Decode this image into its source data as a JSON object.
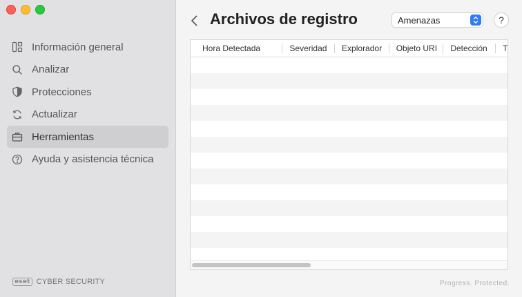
{
  "sidebar": {
    "items": [
      {
        "label": "Información general",
        "icon": "dashboard-icon"
      },
      {
        "label": "Analizar",
        "icon": "search-icon"
      },
      {
        "label": "Protecciones",
        "icon": "shield-icon"
      },
      {
        "label": "Actualizar",
        "icon": "refresh-icon"
      },
      {
        "label": "Herramientas",
        "icon": "briefcase-icon",
        "active": true
      },
      {
        "label": "Ayuda y asistencia técnica",
        "icon": "help-circle-icon"
      }
    ],
    "brand_mark": "eset",
    "brand_text": "CYBER SECURITY"
  },
  "header": {
    "title": "Archivos de registro",
    "filter_value": "Amenazas",
    "help_label": "?"
  },
  "table": {
    "columns": [
      "Hora Detectada",
      "Severidad",
      "Explorador",
      "Objeto URI",
      "Detección",
      "T"
    ],
    "rows": []
  },
  "footer": {
    "tagline": "Progress. Protected."
  },
  "colors": {
    "accent": "#2f7cf6",
    "sidebar_bg": "#e1e1e3",
    "active_item_bg": "#cfcfd1"
  }
}
